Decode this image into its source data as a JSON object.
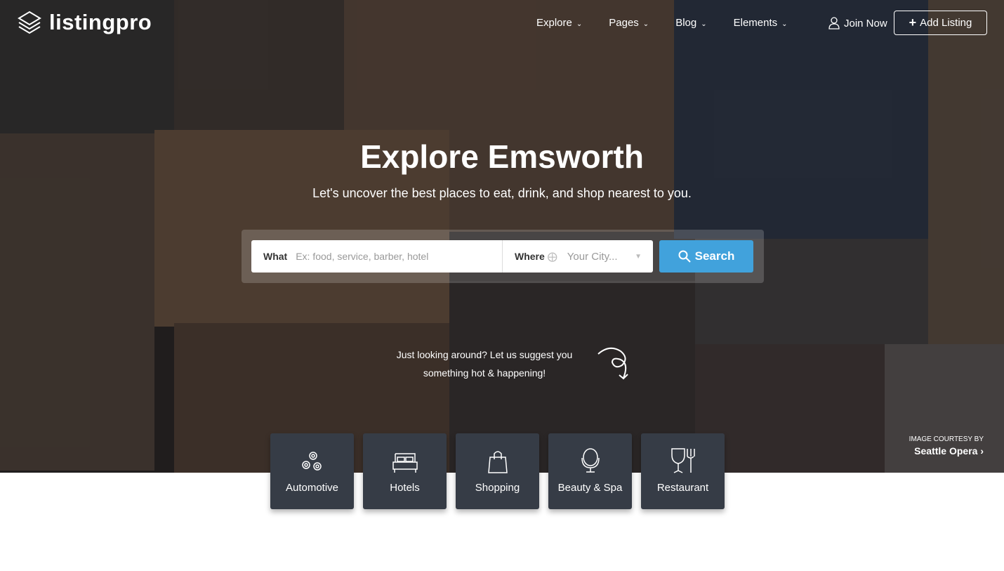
{
  "brand": {
    "name": "listingpro"
  },
  "nav": {
    "items": [
      {
        "label": "Explore"
      },
      {
        "label": "Pages"
      },
      {
        "label": "Blog"
      },
      {
        "label": "Elements"
      }
    ],
    "join": "Join Now",
    "add_listing": "Add Listing"
  },
  "hero": {
    "title": "Explore Emsworth",
    "subtitle": "Let's uncover the best places to eat, drink, and shop nearest to you."
  },
  "search": {
    "what_label": "What",
    "what_placeholder": "Ex: food, service, barber, hotel",
    "where_label": "Where",
    "where_placeholder": "Your City...",
    "button": "Search",
    "accent": "#41a2dc"
  },
  "suggest": {
    "line1": "Just looking around? Let us suggest you",
    "line2": "something hot & happening!"
  },
  "courtesy": {
    "small": "IMAGE COURTESY BY",
    "name": "Seattle Opera"
  },
  "categories": [
    {
      "label": "Automotive",
      "icon": "gears-icon"
    },
    {
      "label": "Hotels",
      "icon": "bed-icon"
    },
    {
      "label": "Shopping",
      "icon": "shopping-bag-icon"
    },
    {
      "label": "Beauty & Spa",
      "icon": "mirror-icon"
    },
    {
      "label": "Restaurant",
      "icon": "glass-fork-icon"
    }
  ]
}
